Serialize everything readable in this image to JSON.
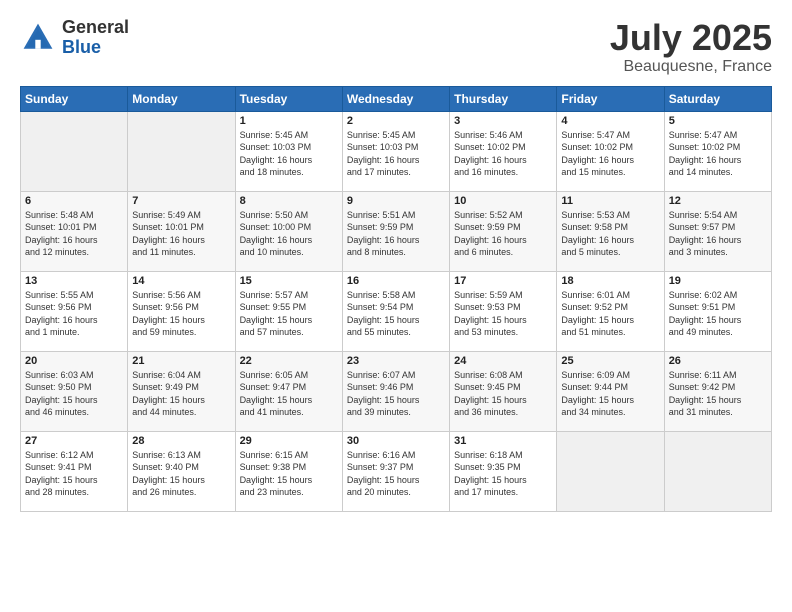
{
  "header": {
    "logo_general": "General",
    "logo_blue": "Blue",
    "month": "July 2025",
    "location": "Beauquesne, France"
  },
  "days_of_week": [
    "Sunday",
    "Monday",
    "Tuesday",
    "Wednesday",
    "Thursday",
    "Friday",
    "Saturday"
  ],
  "weeks": [
    [
      {
        "day": "",
        "info": ""
      },
      {
        "day": "",
        "info": ""
      },
      {
        "day": "1",
        "info": "Sunrise: 5:45 AM\nSunset: 10:03 PM\nDaylight: 16 hours\nand 18 minutes."
      },
      {
        "day": "2",
        "info": "Sunrise: 5:45 AM\nSunset: 10:03 PM\nDaylight: 16 hours\nand 17 minutes."
      },
      {
        "day": "3",
        "info": "Sunrise: 5:46 AM\nSunset: 10:02 PM\nDaylight: 16 hours\nand 16 minutes."
      },
      {
        "day": "4",
        "info": "Sunrise: 5:47 AM\nSunset: 10:02 PM\nDaylight: 16 hours\nand 15 minutes."
      },
      {
        "day": "5",
        "info": "Sunrise: 5:47 AM\nSunset: 10:02 PM\nDaylight: 16 hours\nand 14 minutes."
      }
    ],
    [
      {
        "day": "6",
        "info": "Sunrise: 5:48 AM\nSunset: 10:01 PM\nDaylight: 16 hours\nand 12 minutes."
      },
      {
        "day": "7",
        "info": "Sunrise: 5:49 AM\nSunset: 10:01 PM\nDaylight: 16 hours\nand 11 minutes."
      },
      {
        "day": "8",
        "info": "Sunrise: 5:50 AM\nSunset: 10:00 PM\nDaylight: 16 hours\nand 10 minutes."
      },
      {
        "day": "9",
        "info": "Sunrise: 5:51 AM\nSunset: 9:59 PM\nDaylight: 16 hours\nand 8 minutes."
      },
      {
        "day": "10",
        "info": "Sunrise: 5:52 AM\nSunset: 9:59 PM\nDaylight: 16 hours\nand 6 minutes."
      },
      {
        "day": "11",
        "info": "Sunrise: 5:53 AM\nSunset: 9:58 PM\nDaylight: 16 hours\nand 5 minutes."
      },
      {
        "day": "12",
        "info": "Sunrise: 5:54 AM\nSunset: 9:57 PM\nDaylight: 16 hours\nand 3 minutes."
      }
    ],
    [
      {
        "day": "13",
        "info": "Sunrise: 5:55 AM\nSunset: 9:56 PM\nDaylight: 16 hours\nand 1 minute."
      },
      {
        "day": "14",
        "info": "Sunrise: 5:56 AM\nSunset: 9:56 PM\nDaylight: 15 hours\nand 59 minutes."
      },
      {
        "day": "15",
        "info": "Sunrise: 5:57 AM\nSunset: 9:55 PM\nDaylight: 15 hours\nand 57 minutes."
      },
      {
        "day": "16",
        "info": "Sunrise: 5:58 AM\nSunset: 9:54 PM\nDaylight: 15 hours\nand 55 minutes."
      },
      {
        "day": "17",
        "info": "Sunrise: 5:59 AM\nSunset: 9:53 PM\nDaylight: 15 hours\nand 53 minutes."
      },
      {
        "day": "18",
        "info": "Sunrise: 6:01 AM\nSunset: 9:52 PM\nDaylight: 15 hours\nand 51 minutes."
      },
      {
        "day": "19",
        "info": "Sunrise: 6:02 AM\nSunset: 9:51 PM\nDaylight: 15 hours\nand 49 minutes."
      }
    ],
    [
      {
        "day": "20",
        "info": "Sunrise: 6:03 AM\nSunset: 9:50 PM\nDaylight: 15 hours\nand 46 minutes."
      },
      {
        "day": "21",
        "info": "Sunrise: 6:04 AM\nSunset: 9:49 PM\nDaylight: 15 hours\nand 44 minutes."
      },
      {
        "day": "22",
        "info": "Sunrise: 6:05 AM\nSunset: 9:47 PM\nDaylight: 15 hours\nand 41 minutes."
      },
      {
        "day": "23",
        "info": "Sunrise: 6:07 AM\nSunset: 9:46 PM\nDaylight: 15 hours\nand 39 minutes."
      },
      {
        "day": "24",
        "info": "Sunrise: 6:08 AM\nSunset: 9:45 PM\nDaylight: 15 hours\nand 36 minutes."
      },
      {
        "day": "25",
        "info": "Sunrise: 6:09 AM\nSunset: 9:44 PM\nDaylight: 15 hours\nand 34 minutes."
      },
      {
        "day": "26",
        "info": "Sunrise: 6:11 AM\nSunset: 9:42 PM\nDaylight: 15 hours\nand 31 minutes."
      }
    ],
    [
      {
        "day": "27",
        "info": "Sunrise: 6:12 AM\nSunset: 9:41 PM\nDaylight: 15 hours\nand 28 minutes."
      },
      {
        "day": "28",
        "info": "Sunrise: 6:13 AM\nSunset: 9:40 PM\nDaylight: 15 hours\nand 26 minutes."
      },
      {
        "day": "29",
        "info": "Sunrise: 6:15 AM\nSunset: 9:38 PM\nDaylight: 15 hours\nand 23 minutes."
      },
      {
        "day": "30",
        "info": "Sunrise: 6:16 AM\nSunset: 9:37 PM\nDaylight: 15 hours\nand 20 minutes."
      },
      {
        "day": "31",
        "info": "Sunrise: 6:18 AM\nSunset: 9:35 PM\nDaylight: 15 hours\nand 17 minutes."
      },
      {
        "day": "",
        "info": ""
      },
      {
        "day": "",
        "info": ""
      }
    ]
  ]
}
